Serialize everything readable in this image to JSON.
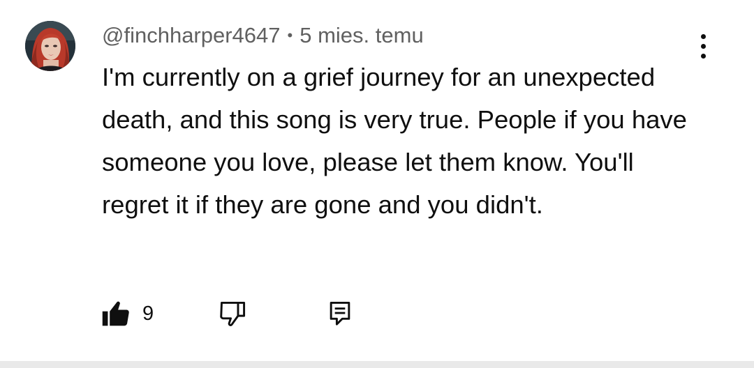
{
  "comment": {
    "author": "@finchharper4647",
    "separator": "•",
    "time_ago": "5 mies. temu",
    "text": "I'm currently on a grief journey for an unexpected death, and this song is very true. People if you have someone you love, please let them know. You'll regret it if they are gone and you didn't.",
    "like_count": "9",
    "liked": true
  },
  "icons": {
    "menu": "more-vertical-icon",
    "like": "thumbs-up-filled-icon",
    "dislike": "thumbs-down-icon",
    "reply": "comment-icon"
  },
  "colors": {
    "text_primary": "#0f0f0f",
    "text_secondary": "#606060",
    "background": "#ffffff",
    "divider": "#e9e9e9"
  }
}
